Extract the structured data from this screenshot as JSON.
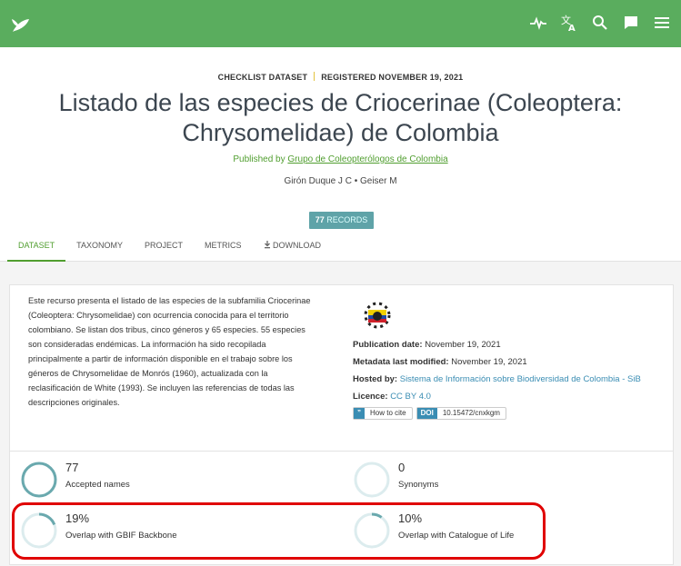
{
  "icons": {
    "logo": "gbif-leaf-icon",
    "health": "activity-icon",
    "translate": "translate-icon",
    "search": "search-icon",
    "feedback": "chat-bubble-icon",
    "menu": "hamburger-menu-icon",
    "download": "download-icon"
  },
  "header": {
    "type": "CHECKLIST DATASET",
    "registered": "REGISTERED NOVEMBER 19, 2021",
    "title": "Listado de las especies de Criocerinae (Coleoptera: Chrysomelidae) de Colombia",
    "published_by_prefix": "Published by",
    "publisher": "Grupo de Coleopterólogos de Colombia",
    "authors": "Girón Duque J C • Geiser M",
    "records_count": "77",
    "records_label": "RECORDS"
  },
  "tabs": [
    {
      "label": "DATASET",
      "active": true
    },
    {
      "label": "TAXONOMY",
      "active": false
    },
    {
      "label": "PROJECT",
      "active": false
    },
    {
      "label": "METRICS",
      "active": false
    },
    {
      "label": "DOWNLOAD",
      "active": false
    }
  ],
  "dataset": {
    "description": "Este recurso presenta el listado de las especies de la subfamilia Criocerinae (Coleoptera: Chrysomelidae) con ocurrencia conocida para el territorio colombiano. Se listan dos tribus, cinco géneros y 65 especies. 55 especies son consideradas endémicas. La información ha sido recopilada principalmente a partir de información disponible en el trabajo sobre los géneros de Chrysomelidae de Monrós (1960), actualizada con la reclasificación de White (1993). Se incluyen las referencias de todas las descripciones originales.",
    "publication_label": "Publication date:",
    "publication_value": "November 19, 2021",
    "modified_label": "Metadata last modified:",
    "modified_value": "November 19, 2021",
    "hosted_label": "Hosted by:",
    "hosted_value": "Sistema de Información sobre Biodiversidad de Colombia - SiB",
    "licence_label": "Licence:",
    "licence_value": "CC BY 4.0",
    "cite_icon": "”",
    "cite_label": "How to cite",
    "doi_label": "DOI",
    "doi_value": "10.15472/cnxkgm"
  },
  "stats": [
    {
      "value": "77",
      "label": "Accepted names",
      "fraction": 1.0,
      "color": "#6aa9ae"
    },
    {
      "value": "0",
      "label": "Synonyms",
      "fraction": 0.0,
      "color": "#6aa9ae"
    },
    {
      "value": "19%",
      "label": "Overlap with GBIF Backbone",
      "fraction": 0.19,
      "color": "#6aa9ae"
    },
    {
      "value": "10%",
      "label": "Overlap with Catalogue of Life",
      "fraction": 0.1,
      "color": "#6aa9ae"
    }
  ],
  "colors": {
    "topbar": "#5aad5e",
    "accent": "#509e2f",
    "link": "#3a8db3",
    "records_badge": "#5fa3a8",
    "highlight": "#e00000"
  }
}
